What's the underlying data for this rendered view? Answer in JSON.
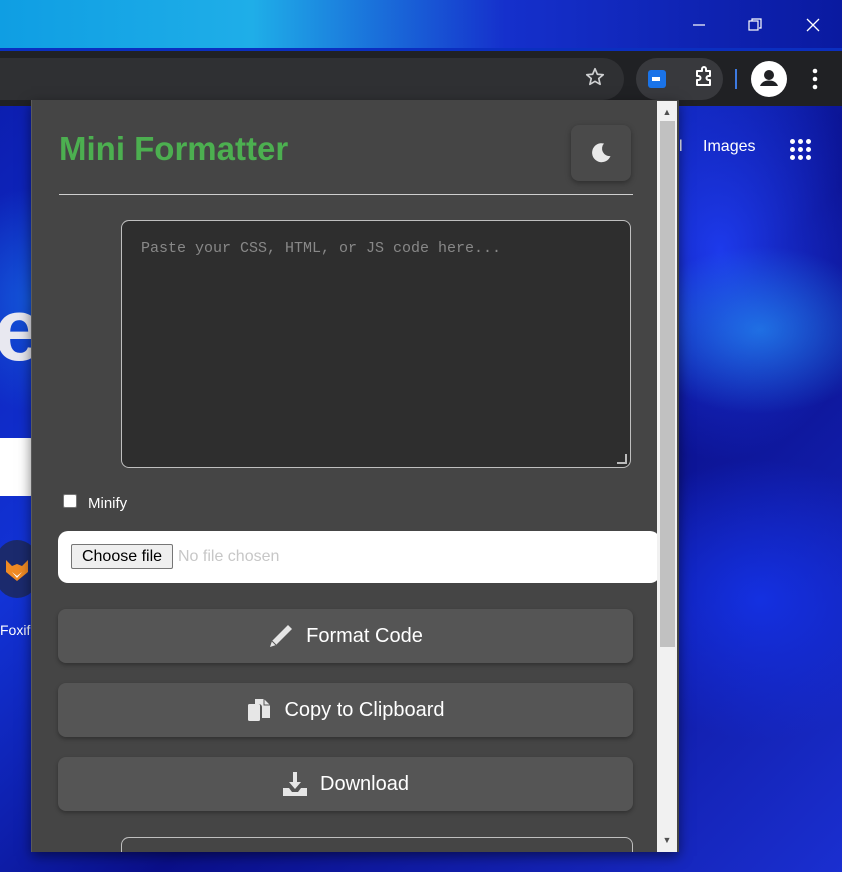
{
  "window": {
    "minimize_icon": "minimize-icon",
    "restore_icon": "restore-icon",
    "close_icon": "close-icon"
  },
  "browser": {
    "bookmark_icon": "star-icon",
    "extensions_icon": "puzzle-icon",
    "profile_icon": "person-icon",
    "menu_icon": "more-vert-icon"
  },
  "page_behind": {
    "links": [
      "l",
      "Images"
    ],
    "apps_icon": "apps-grid-icon",
    "shortcut_label": "Foxifi"
  },
  "popup": {
    "title": "Mini Formatter",
    "title_color": "#4caf50",
    "theme_icon": "moon-icon",
    "code_input": {
      "placeholder": "Paste your CSS, HTML, or JS code here...",
      "value": ""
    },
    "minify": {
      "label": "Minify",
      "checked": false
    },
    "file_input": {
      "button_label": "Choose file",
      "status": "No file chosen"
    },
    "buttons": {
      "format": {
        "label": "Format Code",
        "icon": "pencil-icon"
      },
      "copy": {
        "label": "Copy to Clipboard",
        "icon": "copy-icon"
      },
      "download": {
        "label": "Download",
        "icon": "download-icon"
      }
    }
  }
}
